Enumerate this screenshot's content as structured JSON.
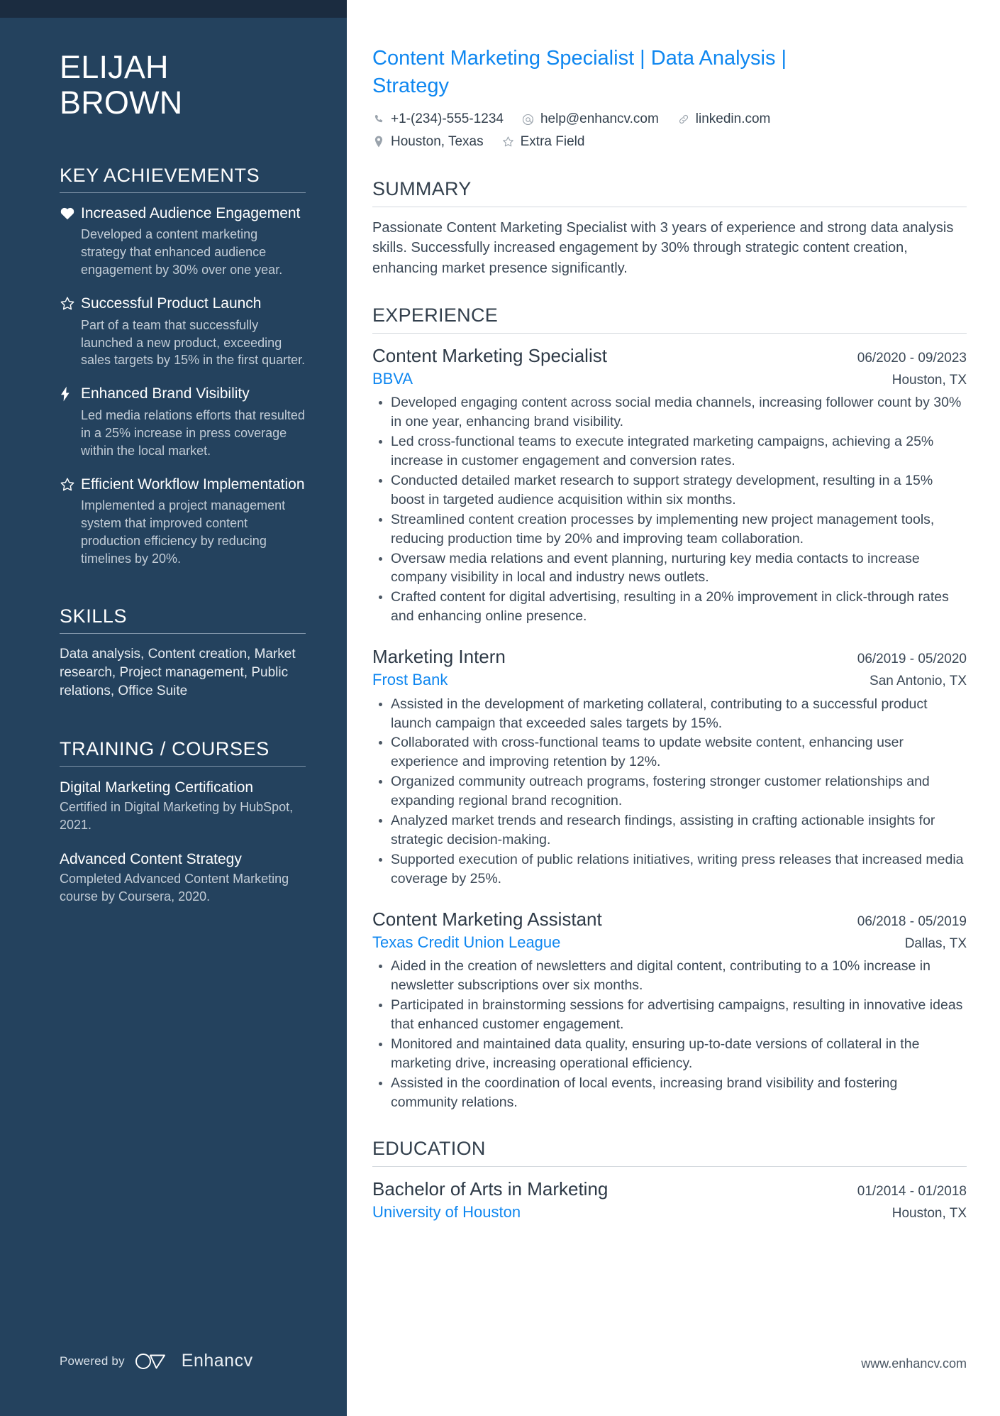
{
  "theme": {
    "sidebar_bg": "#24425e",
    "sidebar_topbar_bg": "#1b2c40",
    "accent_blue": "#0f87f0",
    "body_text": "#3b4856"
  },
  "sidebar": {
    "name_line1": "ELIJAH",
    "name_line2": "BROWN",
    "achievements": {
      "heading": "KEY ACHIEVEMENTS",
      "items": [
        {
          "icon": "heart-icon",
          "title": "Increased Audience Engagement",
          "description": "Developed a content marketing strategy that enhanced audience engagement by 30% over one year."
        },
        {
          "icon": "star-icon",
          "title": "Successful Product Launch",
          "description": "Part of a team that successfully launched a new product, exceeding sales targets by 15% in the first quarter."
        },
        {
          "icon": "bolt-icon",
          "title": "Enhanced Brand Visibility",
          "description": "Led media relations efforts that resulted in a 25% increase in press coverage within the local market."
        },
        {
          "icon": "star-icon",
          "title": "Efficient Workflow Implementation",
          "description": "Implemented a project management system that improved content production efficiency by reducing timelines by 20%."
        }
      ]
    },
    "skills": {
      "heading": "SKILLS",
      "text": "Data analysis, Content creation, Market research, Project management, Public relations, Office Suite"
    },
    "training": {
      "heading": "TRAINING / COURSES",
      "items": [
        {
          "title": "Digital Marketing Certification",
          "description": "Certified in Digital Marketing by HubSpot, 2021."
        },
        {
          "title": "Advanced Content Strategy",
          "description": "Completed Advanced Content Marketing course by Coursera, 2020."
        }
      ]
    },
    "footer": {
      "powered_by": "Powered by",
      "brand": "Enhancv"
    }
  },
  "main": {
    "headline": "Content Marketing Specialist | Data Analysis | Strategy",
    "contacts": [
      {
        "icon": "phone-icon",
        "value": "+1-(234)-555-1234"
      },
      {
        "icon": "at-icon",
        "value": "help@enhancv.com"
      },
      {
        "icon": "link-icon",
        "value": "linkedin.com"
      },
      {
        "icon": "location-pin-icon",
        "value": "Houston, Texas"
      },
      {
        "icon": "star-icon",
        "value": "Extra Field"
      }
    ],
    "summary": {
      "heading": "SUMMARY",
      "text": "Passionate Content Marketing Specialist with 3 years of experience and strong data analysis skills. Successfully increased engagement by 30% through strategic content creation, enhancing market presence significantly."
    },
    "experience": {
      "heading": "EXPERIENCE",
      "entries": [
        {
          "title": "Content Marketing Specialist",
          "date": "06/2020 - 09/2023",
          "organization": "BBVA",
          "location": "Houston, TX",
          "bullets": [
            "Developed engaging content across social media channels, increasing follower count by 30% in one year, enhancing brand visibility.",
            "Led cross-functional teams to execute integrated marketing campaigns, achieving a 25% increase in customer engagement and conversion rates.",
            "Conducted detailed market research to support strategy development, resulting in a 15% boost in targeted audience acquisition within six months.",
            "Streamlined content creation processes by implementing new project management tools, reducing production time by 20% and improving team collaboration.",
            "Oversaw media relations and event planning, nurturing key media contacts to increase company visibility in local and industry news outlets.",
            "Crafted content for digital advertising, resulting in a 20% improvement in click-through rates and enhancing online presence."
          ]
        },
        {
          "title": "Marketing Intern",
          "date": "06/2019 - 05/2020",
          "organization": "Frost Bank",
          "location": "San Antonio, TX",
          "bullets": [
            "Assisted in the development of marketing collateral, contributing to a successful product launch campaign that exceeded sales targets by 15%.",
            "Collaborated with cross-functional teams to update website content, enhancing user experience and improving retention by 12%.",
            "Organized community outreach programs, fostering stronger customer relationships and expanding regional brand recognition.",
            "Analyzed market trends and research findings, assisting in crafting actionable insights for strategic decision-making.",
            "Supported execution of public relations initiatives, writing press releases that increased media coverage by 25%."
          ]
        },
        {
          "title": "Content Marketing Assistant",
          "date": "06/2018 - 05/2019",
          "organization": "Texas Credit Union League",
          "location": "Dallas, TX",
          "bullets": [
            "Aided in the creation of newsletters and digital content, contributing to a 10% increase in newsletter subscriptions over six months.",
            "Participated in brainstorming sessions for advertising campaigns, resulting in innovative ideas that enhanced customer engagement.",
            "Monitored and maintained data quality, ensuring up-to-date versions of collateral in the marketing drive, increasing operational efficiency.",
            "Assisted in the coordination of local events, increasing brand visibility and fostering community relations."
          ]
        }
      ]
    },
    "education": {
      "heading": "EDUCATION",
      "entries": [
        {
          "title": "Bachelor of Arts in Marketing",
          "date": "01/2014 - 01/2018",
          "organization": "University of Houston",
          "location": "Houston, TX"
        }
      ]
    },
    "footer_url": "www.enhancv.com"
  }
}
